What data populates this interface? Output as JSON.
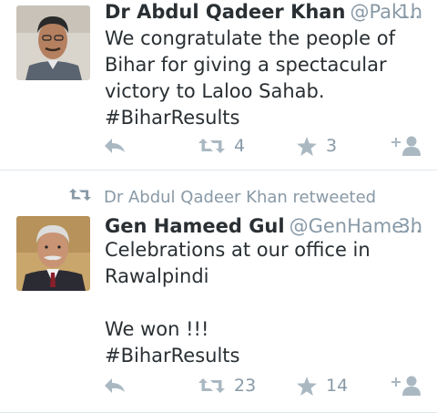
{
  "timeline": {
    "tweets": [
      {
        "name": "Dr Abdul Qadeer Khan",
        "handle": "@Pak...",
        "time": "1h",
        "text": "We congratulate the people of Bihar for giving a spectacular victory to Laloo Sahab. #BiharResults",
        "retweets": "4",
        "favorites": "3"
      },
      {
        "retweet_context": "Dr Abdul Qadeer Khan retweeted",
        "name": "Gen Hameed Gul",
        "handle": "@GenHame...",
        "time": "3h",
        "text": "Celebrations at our office in Rawalpindi\n\nWe won  !!!\n#BiharResults",
        "retweets": "23",
        "favorites": "14"
      }
    ]
  },
  "colors": {
    "secondary_text": "#8899a6",
    "primary_text": "#292f33",
    "divider": "#e1e8ed",
    "icon": "#aab8c2"
  },
  "icons": [
    "reply-icon",
    "retweet-icon",
    "favorite-star-icon",
    "follow-icon"
  ]
}
